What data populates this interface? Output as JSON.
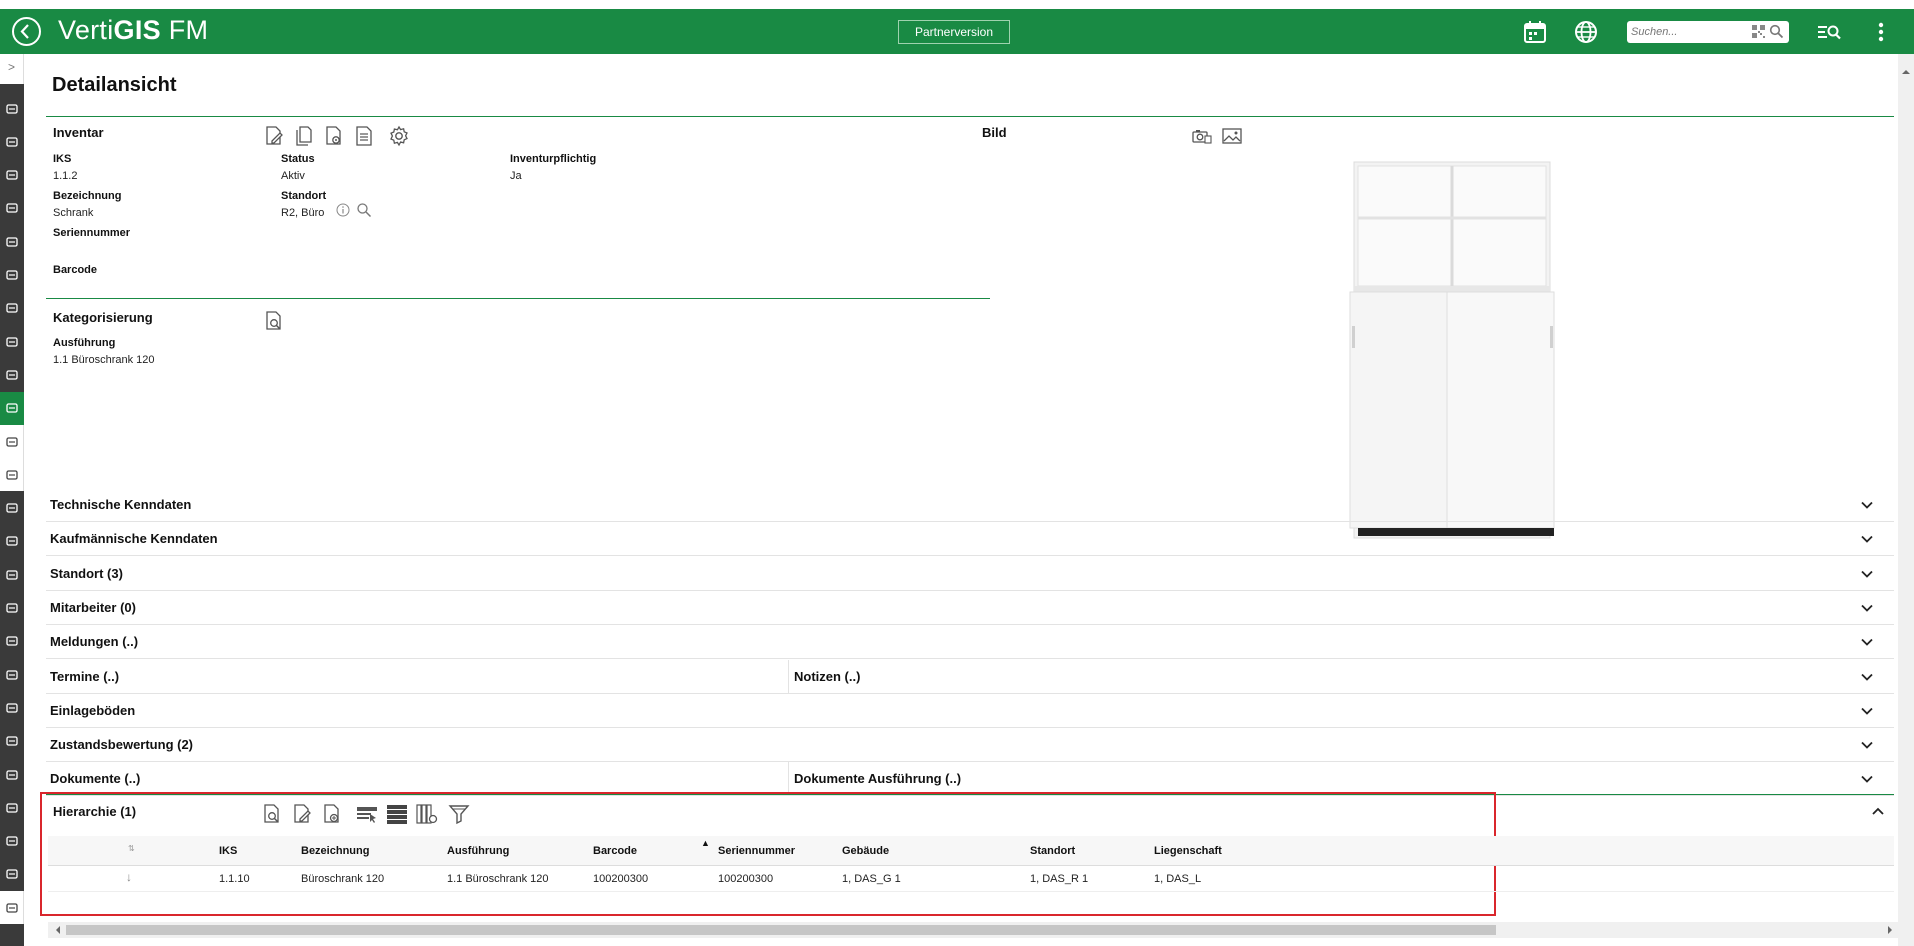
{
  "header": {
    "back_label": "‹",
    "logo_light": "Verti",
    "logo_bold": "GIS",
    "logo_suffix": " FM",
    "partner_label": "Partnerversion",
    "search_placeholder": "Suchen..."
  },
  "sidebar": {
    "toggle": ">",
    "items": [
      "home-icon",
      "building-icon",
      "person-icon",
      "house-icon",
      "money-icon",
      "card-icon",
      "card-icon",
      "gear-icon",
      "tools-icon",
      "inventory-icon",
      "org-icon",
      "search-list-icon",
      "hand-icon",
      "plant-icon",
      "dollar-icon",
      "euro-icon",
      "euro-search-icon",
      "drop-icon",
      "hand-coin-icon",
      "truck-icon",
      "house-gear-icon",
      "list-icon",
      "cleaning-icon",
      "bottle-icon",
      "user-icon"
    ]
  },
  "page": {
    "title": "Detailansicht"
  },
  "inventar": {
    "title": "Inventar",
    "fields": {
      "iks_label": "IKS",
      "iks_value": "1.1.2",
      "status_label": "Status",
      "status_value": "Aktiv",
      "inventurpflichtig_label": "Inventurpflichtig",
      "inventurpflichtig_value": "Ja",
      "bezeichnung_label": "Bezeichnung",
      "bezeichnung_value": "Schrank",
      "standort_label": "Standort",
      "standort_value": "R2, Büro",
      "seriennummer_label": "Seriennummer",
      "barcode_label": "Barcode"
    }
  },
  "bild": {
    "title": "Bild"
  },
  "kategorisierung": {
    "title": "Kategorisierung",
    "ausfuehrung_label": "Ausführung",
    "ausfuehrung_value": "1.1 Büroschrank 120"
  },
  "accordion": [
    {
      "title": "Technische Kenndaten"
    },
    {
      "title": "Kaufmännische Kenndaten"
    },
    {
      "title": "Standort (3)"
    },
    {
      "title": "Mitarbeiter (0)"
    },
    {
      "title": "Meldungen (..)"
    },
    {
      "title": "Termine (..)",
      "right": "Notizen (..)"
    },
    {
      "title": "Einlageböden"
    },
    {
      "title": "Zustandsbewertung (2)"
    },
    {
      "title": "Dokumente (..)",
      "right": "Dokumente Ausführung (..)"
    }
  ],
  "hierarchie": {
    "title": "Hierarchie (1)",
    "columns": [
      "IKS",
      "Bezeichnung",
      "Ausführung",
      "Barcode",
      "Seriennummer",
      "Gebäude",
      "Standort",
      "Liegenschaft"
    ],
    "rows": [
      [
        "1.1.10",
        "Büroschrank 120",
        "1.1 Büroschrank 120",
        "100200300",
        "100200300",
        "1, DAS_G 1",
        "1, DAS_R 1",
        "1, DAS_L"
      ]
    ]
  },
  "colors": {
    "brand_green": "#198a44",
    "highlight_red": "#d9262c"
  }
}
